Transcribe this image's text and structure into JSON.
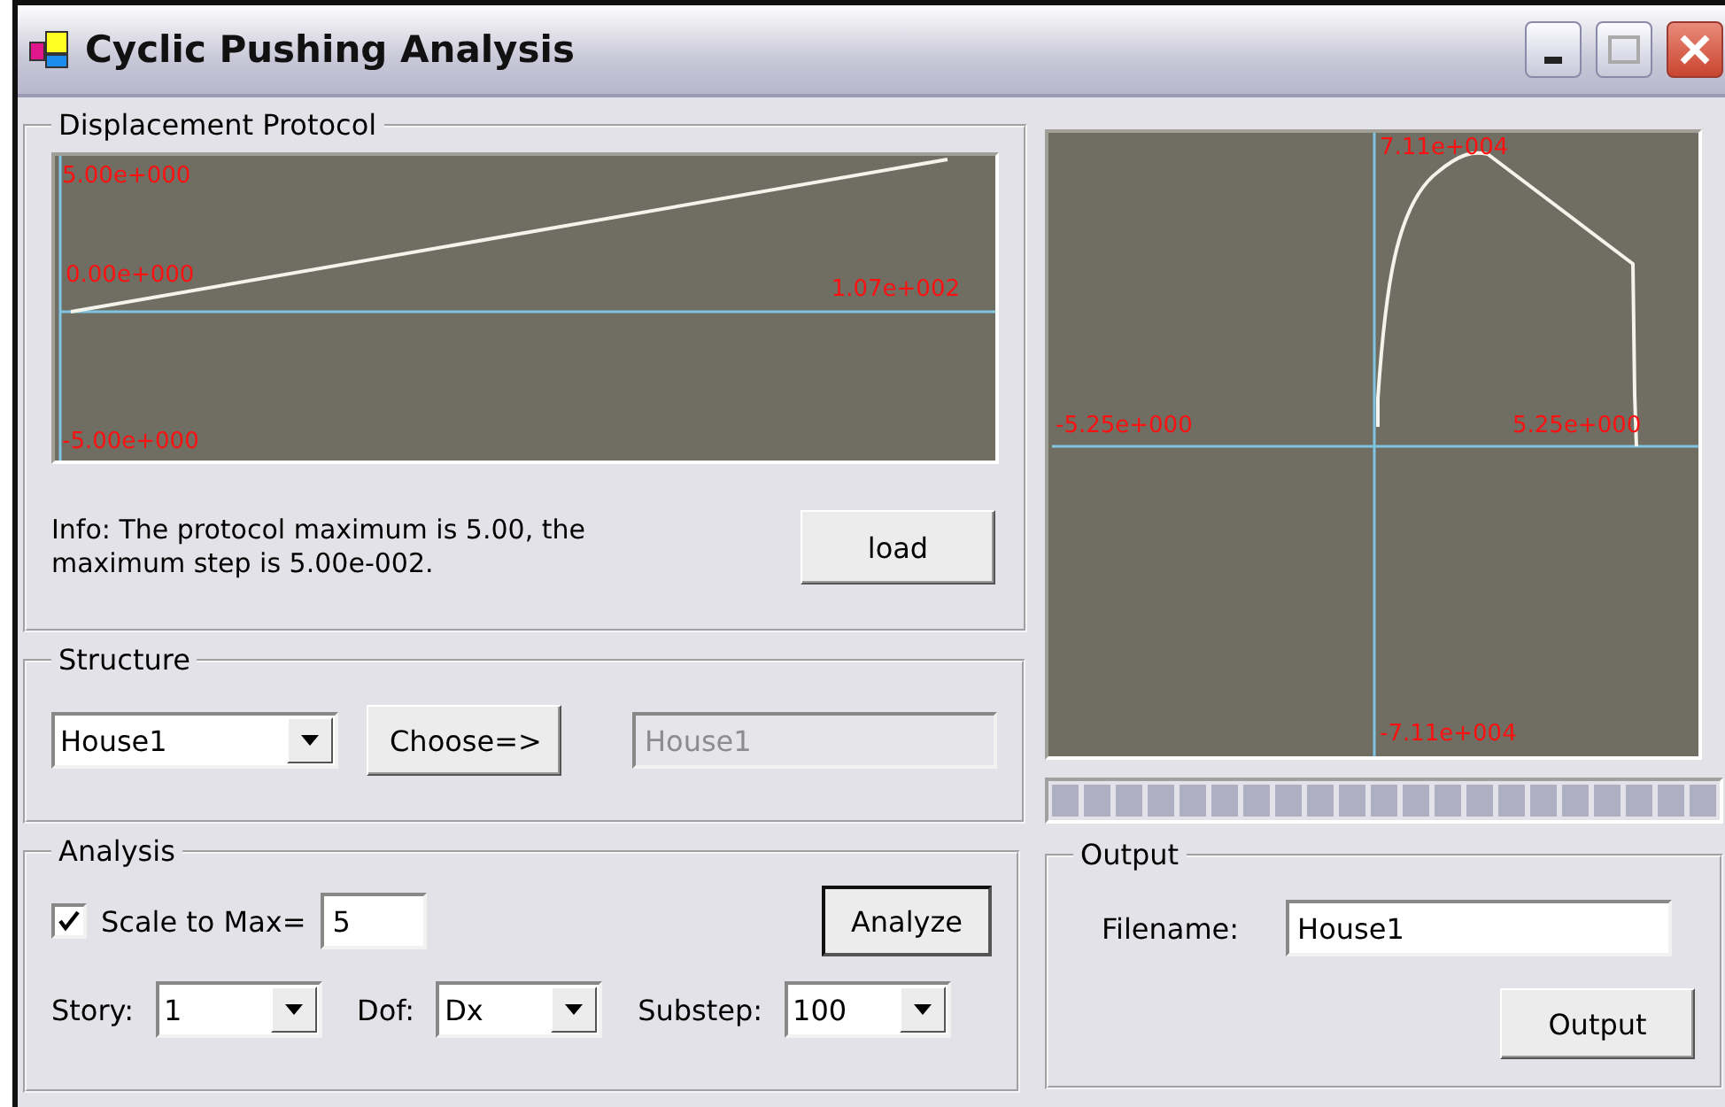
{
  "window": {
    "title": "Cyclic Pushing Analysis"
  },
  "displacement_protocol": {
    "title": "Displacement Protocol",
    "plot_labels": {
      "y_max": "5.00e+000",
      "origin": "0.00e+000",
      "x_max": "1.07e+002",
      "y_min": "-5.00e+000"
    },
    "info": "Info: The protocol maximum is 5.00, the maximum step is 5.00e-002.",
    "load_button": "load"
  },
  "structure": {
    "title": "Structure",
    "selector": {
      "value": "House1"
    },
    "choose_button": "Choose=>",
    "selected_field": {
      "value": "House1",
      "disabled": true
    }
  },
  "analysis": {
    "title": "Analysis",
    "scale_to_max": {
      "label": "Scale to Max=",
      "checked": true,
      "value": "5"
    },
    "analyze_button": "Analyze",
    "dropdowns": [
      {
        "label": "Story:",
        "value": "1"
      },
      {
        "label": "Dof:",
        "value": "Dx"
      },
      {
        "label": "Substep:",
        "value": "100"
      }
    ]
  },
  "response_plot": {
    "labels": {
      "y_max": "7.11e+004",
      "x_min": "-5.25e+000",
      "x_max": "5.25e+000",
      "y_min": "-7.11e+004"
    }
  },
  "progress": {
    "level": 1
  },
  "output": {
    "title": "Output",
    "filename_label": "Filename:",
    "filename": "House1",
    "output_button": "Output"
  }
}
